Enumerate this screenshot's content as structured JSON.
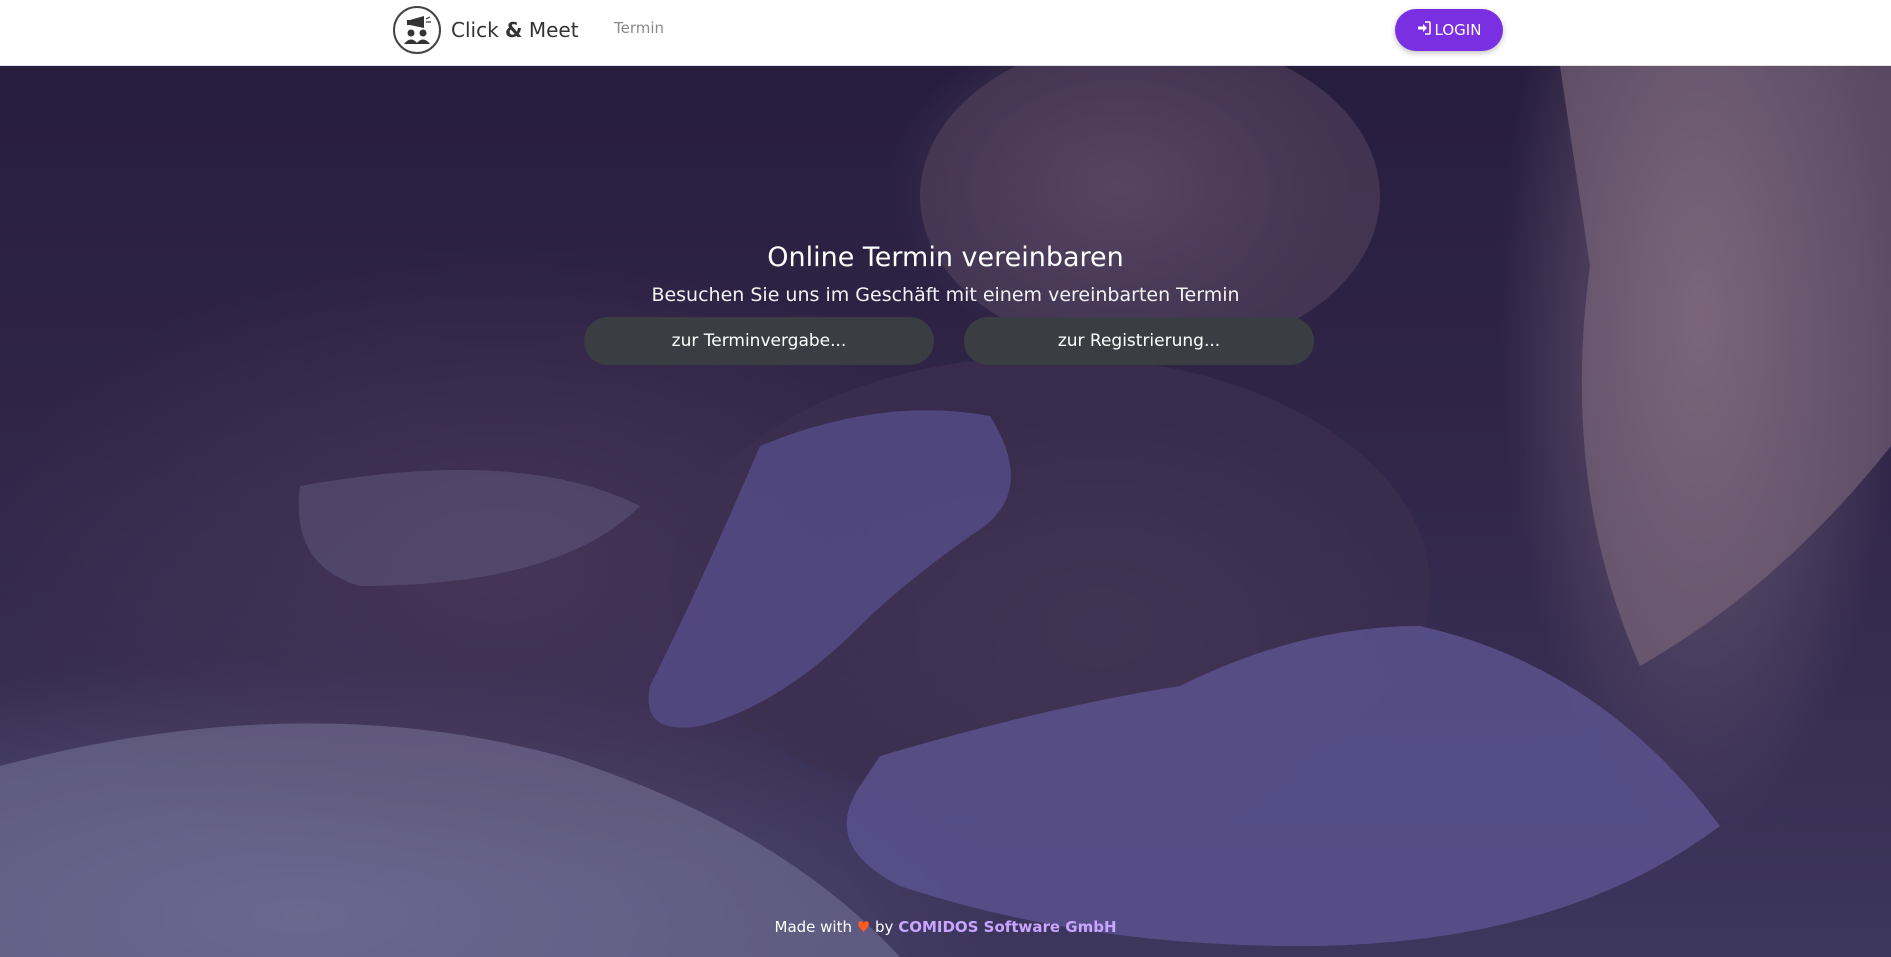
{
  "header": {
    "brand": {
      "part1": "Click ",
      "amp": "&",
      "part2": " Meet",
      "logo_icon": "megaphone-people-icon"
    },
    "nav": {
      "termin": "Termin"
    },
    "login": {
      "label": "LOGIN",
      "icon": "sign-in-icon",
      "color": "#7a2fe3"
    }
  },
  "hero": {
    "title": "Online Termin vereinbaren",
    "subtitle": "Besuchen Sie uns im Geschäft mit einem vereinbarten Termin",
    "buttons": {
      "appointment": "zur Terminvergabe...",
      "register": "zur Registrierung..."
    }
  },
  "footer": {
    "made_with": "Made with",
    "heart": "♥",
    "by": "by",
    "company": "COMIDOS Software GmbH"
  },
  "colors": {
    "accent": "#7a2fe3",
    "button_dark": "#3a3d42",
    "heart": "#ff5a1f",
    "company_link": "#c9a5ff"
  }
}
